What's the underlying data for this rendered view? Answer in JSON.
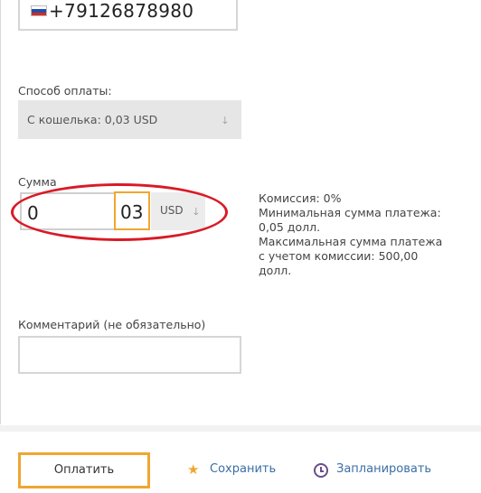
{
  "phone": {
    "value": "+79126878980",
    "flag": "russia-flag-icon"
  },
  "payment_method": {
    "label": "Способ оплаты:",
    "value": "С кошелька: 0,03 USD"
  },
  "amount": {
    "label": "Сумма",
    "whole": "0",
    "fraction": "03",
    "currency": "USD"
  },
  "info": {
    "commission": "Комиссия: 0%",
    "min_amount": "Минимальная сумма платежа:\n0,05 долл.",
    "max_amount": "Максимальная сумма платежа\nс учетом комиссии: 500,00\nдолл."
  },
  "comment": {
    "label": "Комментарий (не обязательно)",
    "value": ""
  },
  "actions": {
    "pay_label": "Оплатить",
    "save_label": "Сохранить",
    "schedule_label": "Запланировать"
  },
  "colors": {
    "accent": "#f0a630",
    "highlight": "#d81b26",
    "link": "#3a6ea5"
  }
}
